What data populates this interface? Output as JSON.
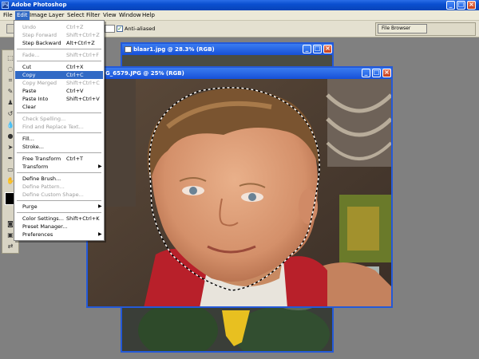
{
  "app": {
    "title": "Adobe Photoshop",
    "icon": "photoshop-app-icon"
  },
  "menubar": {
    "items": [
      "File",
      "Edit",
      "Image",
      "Layer",
      "Select",
      "Filter",
      "View",
      "Window",
      "Help"
    ],
    "active": "Edit"
  },
  "options": {
    "antialias_label": "Anti-aliased",
    "antialias_checked": true,
    "file_browser_label": "File Browser"
  },
  "docs": {
    "back": {
      "title": "blaar1.jpg @ 28.3% (RGB)"
    },
    "front": {
      "title": "G_6579.JPG @ 25% (RGB)"
    }
  },
  "edit_menu": {
    "items": [
      {
        "label": "Undo",
        "shortcut": "Ctrl+Z",
        "disabled": true
      },
      {
        "label": "Step Forward",
        "shortcut": "Shift+Ctrl+Z",
        "disabled": true
      },
      {
        "label": "Step Backward",
        "shortcut": "Alt+Ctrl+Z",
        "disabled": false
      },
      {
        "label": "Fade...",
        "shortcut": "Shift+Ctrl+F",
        "disabled": true
      },
      {
        "label": "Cut",
        "shortcut": "Ctrl+X",
        "disabled": false
      },
      {
        "label": "Copy",
        "shortcut": "Ctrl+C",
        "disabled": false,
        "highlighted": true
      },
      {
        "label": "Copy Merged",
        "shortcut": "Shift+Ctrl+C",
        "disabled": true
      },
      {
        "label": "Paste",
        "shortcut": "Ctrl+V",
        "disabled": false
      },
      {
        "label": "Paste Into",
        "shortcut": "Shift+Ctrl+V",
        "disabled": false
      },
      {
        "label": "Clear",
        "shortcut": "",
        "disabled": false
      },
      {
        "label": "Check Spelling...",
        "shortcut": "",
        "disabled": true
      },
      {
        "label": "Find and Replace Text...",
        "shortcut": "",
        "disabled": true
      },
      {
        "label": "Fill...",
        "shortcut": "",
        "disabled": false
      },
      {
        "label": "Stroke...",
        "shortcut": "",
        "disabled": false
      },
      {
        "label": "Free Transform",
        "shortcut": "Ctrl+T",
        "disabled": false
      },
      {
        "label": "Transform",
        "shortcut": "",
        "disabled": false,
        "submenu": true
      },
      {
        "label": "Define Brush...",
        "shortcut": "",
        "disabled": false
      },
      {
        "label": "Define Pattern...",
        "shortcut": "",
        "disabled": true
      },
      {
        "label": "Define Custom Shape...",
        "shortcut": "",
        "disabled": true
      },
      {
        "label": "Purge",
        "shortcut": "",
        "disabled": false,
        "submenu": true
      },
      {
        "label": "Color Settings...",
        "shortcut": "Shift+Ctrl+K",
        "disabled": false
      },
      {
        "label": "Preset Manager...",
        "shortcut": "",
        "disabled": false
      },
      {
        "label": "Preferences",
        "shortcut": "",
        "disabled": false,
        "submenu": true
      }
    ]
  },
  "colors": {
    "selection_blue": "#316ac5",
    "xp_title_blue": "#0a4fd0",
    "menu_bg": "#ece9d8"
  }
}
